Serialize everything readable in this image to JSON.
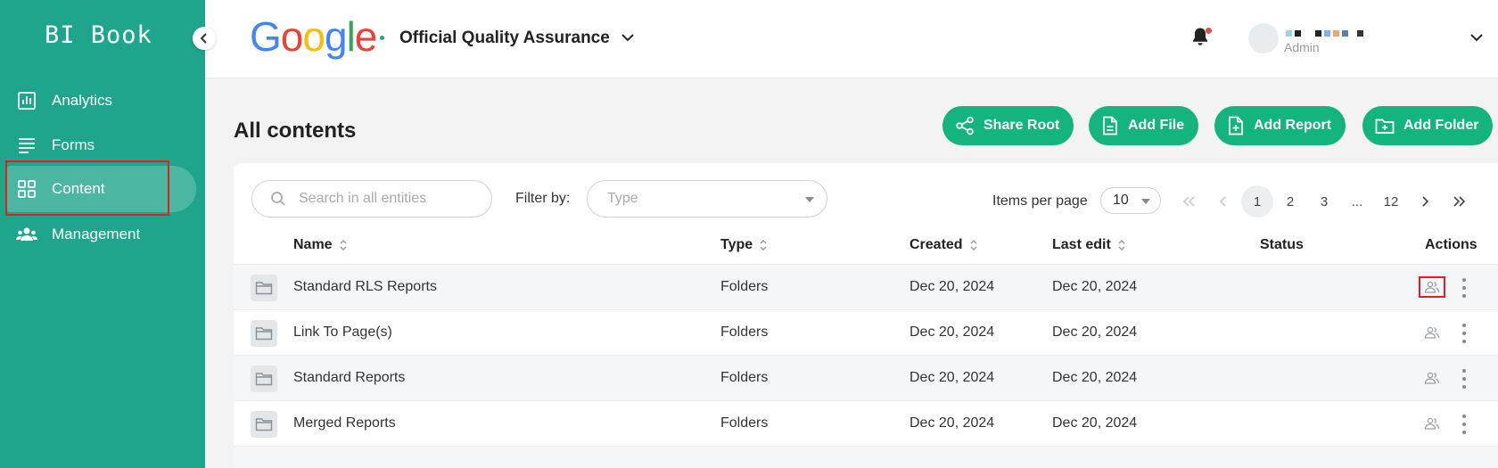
{
  "sidebar": {
    "brand": "BI Book",
    "items": [
      {
        "label": "Analytics",
        "icon": "bar-chart-icon"
      },
      {
        "label": "Forms",
        "icon": "forms-icon"
      },
      {
        "label": "Content",
        "icon": "grid-icon",
        "active": true
      },
      {
        "label": "Management",
        "icon": "users-icon"
      }
    ]
  },
  "header": {
    "logo": "Google",
    "logo_colors": [
      "#4285F4",
      "#EA4335",
      "#FBBC05",
      "#4285F4",
      "#34A853",
      "#EA4335"
    ],
    "org_name": "Official Quality Assurance",
    "user_role": "Admin",
    "notification_dot_color": "#e94b4b"
  },
  "page": {
    "title": "All contents",
    "actions": [
      {
        "label": "Share Root",
        "icon": "share-icon"
      },
      {
        "label": "Add File",
        "icon": "file-icon"
      },
      {
        "label": "Add Report",
        "icon": "add-report-icon"
      },
      {
        "label": "Add Folder",
        "icon": "add-folder-icon"
      }
    ],
    "accent_color": "#13b47d"
  },
  "toolbar": {
    "search_placeholder": "Search in all entities",
    "filter_label": "Filter by:",
    "type_placeholder": "Type",
    "items_per_page_label": "Items per page",
    "items_per_page_value": "10"
  },
  "pagination": {
    "pages": [
      "1",
      "2",
      "3",
      "...",
      "12"
    ],
    "current": "1"
  },
  "table": {
    "columns": [
      "Name",
      "Type",
      "Created",
      "Last edit",
      "Status",
      "Actions"
    ],
    "rows": [
      {
        "name": "Standard RLS Reports",
        "type": "Folders",
        "created": "Dec 20, 2024",
        "last_edit": "Dec 20, 2024",
        "status": ""
      },
      {
        "name": "Link To Page(s)",
        "type": "Folders",
        "created": "Dec 20, 2024",
        "last_edit": "Dec 20, 2024",
        "status": ""
      },
      {
        "name": "Standard Reports",
        "type": "Folders",
        "created": "Dec 20, 2024",
        "last_edit": "Dec 20, 2024",
        "status": ""
      },
      {
        "name": "Merged Reports",
        "type": "Folders",
        "created": "Dec 20, 2024",
        "last_edit": "Dec 20, 2024",
        "status": ""
      }
    ]
  }
}
